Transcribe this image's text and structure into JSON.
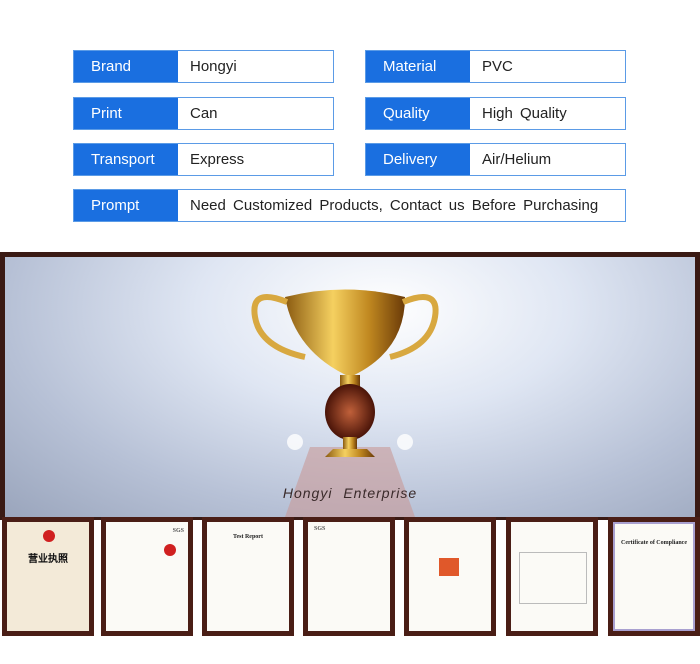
{
  "specs": [
    {
      "label": "Brand",
      "value": "Hongyi"
    },
    {
      "label": "Material",
      "value": "PVC"
    },
    {
      "label": "Print",
      "value": "Can"
    },
    {
      "label": "Quality",
      "value": "High Quality"
    },
    {
      "label": "Transport",
      "value": "Express"
    },
    {
      "label": "Delivery",
      "value": "Air/Helium"
    },
    {
      "label": "Prompt",
      "value": "Need Customized Products, Contact us Before Purchasing"
    }
  ],
  "banner": {
    "company": "Hongyi Enterprise"
  },
  "certificates": [
    {
      "title": "营业执照"
    },
    {
      "title": "SGS"
    },
    {
      "title": "Test Report"
    },
    {
      "title": "SGS"
    },
    {
      "title": ""
    },
    {
      "title": ""
    },
    {
      "title": "Certificate of Compliance"
    }
  ],
  "colors": {
    "label_bg": "#1a6fe0",
    "border": "#5b9be6",
    "frame": "#4a1e16"
  }
}
